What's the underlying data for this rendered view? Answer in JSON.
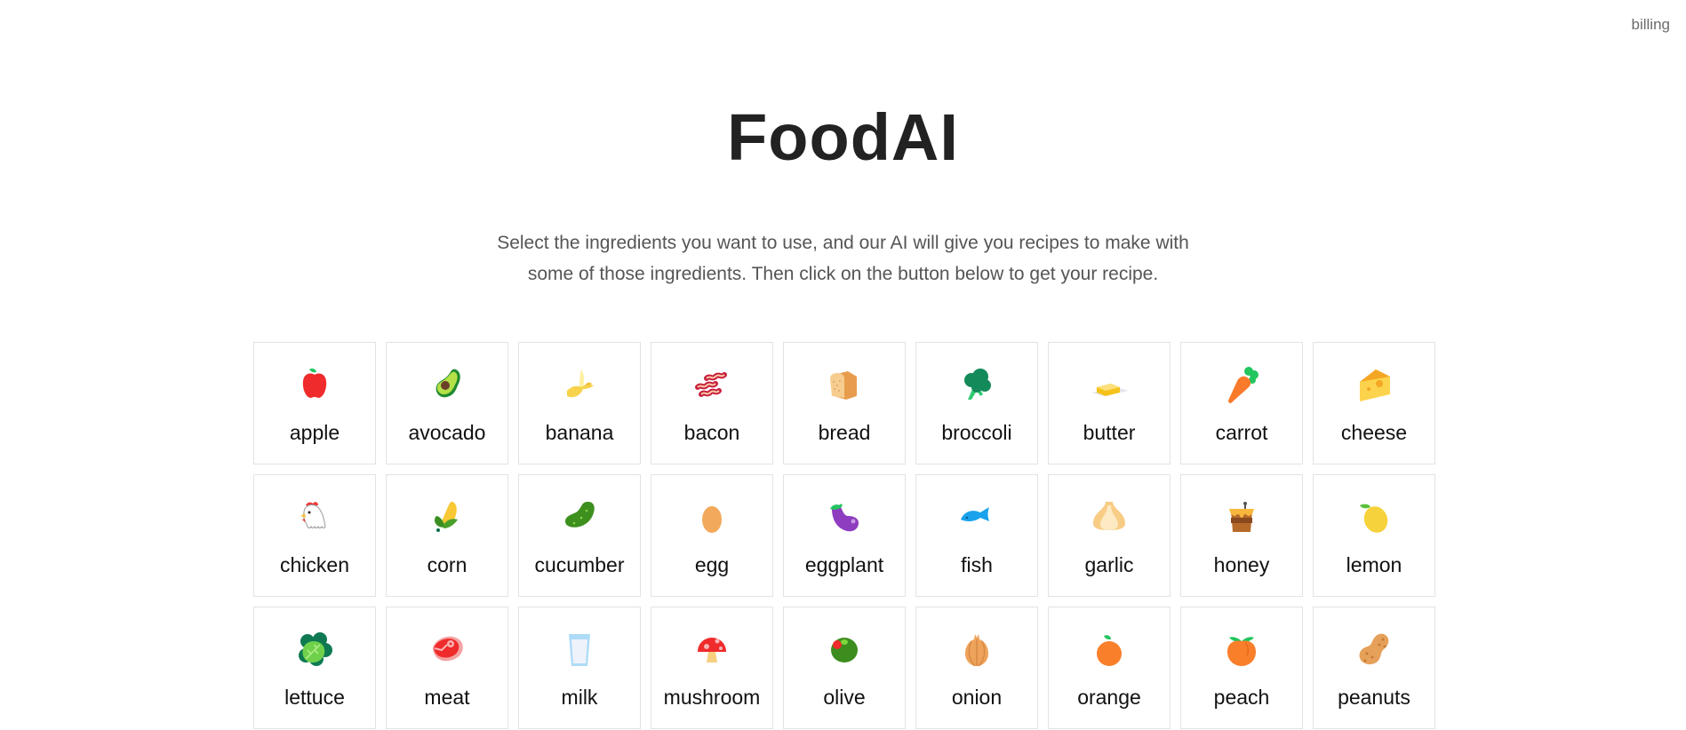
{
  "header": {
    "billing_link": "billing"
  },
  "main": {
    "title": "FoodAI",
    "intro_line1": "Select the ingredients you want to use, and our AI will give you recipes to make with",
    "intro_line2": "some of those ingredients. Then click on the button below to get your recipe."
  },
  "ingredients": [
    {
      "label": "apple",
      "icon": "apple-icon"
    },
    {
      "label": "avocado",
      "icon": "avocado-icon"
    },
    {
      "label": "banana",
      "icon": "banana-icon"
    },
    {
      "label": "bacon",
      "icon": "bacon-icon"
    },
    {
      "label": "bread",
      "icon": "bread-icon"
    },
    {
      "label": "broccoli",
      "icon": "broccoli-icon"
    },
    {
      "label": "butter",
      "icon": "butter-icon"
    },
    {
      "label": "carrot",
      "icon": "carrot-icon"
    },
    {
      "label": "cheese",
      "icon": "cheese-icon"
    },
    {
      "label": "chicken",
      "icon": "chicken-icon"
    },
    {
      "label": "corn",
      "icon": "corn-icon"
    },
    {
      "label": "cucumber",
      "icon": "cucumber-icon"
    },
    {
      "label": "egg",
      "icon": "egg-icon"
    },
    {
      "label": "eggplant",
      "icon": "eggplant-icon"
    },
    {
      "label": "fish",
      "icon": "fish-icon"
    },
    {
      "label": "garlic",
      "icon": "garlic-icon"
    },
    {
      "label": "honey",
      "icon": "honey-icon"
    },
    {
      "label": "lemon",
      "icon": "lemon-icon"
    },
    {
      "label": "lettuce",
      "icon": "lettuce-icon"
    },
    {
      "label": "meat",
      "icon": "meat-icon"
    },
    {
      "label": "milk",
      "icon": "milk-icon"
    },
    {
      "label": "mushroom",
      "icon": "mushroom-icon"
    },
    {
      "label": "olive",
      "icon": "olive-icon"
    },
    {
      "label": "onion",
      "icon": "onion-icon"
    },
    {
      "label": "orange",
      "icon": "orange-icon"
    },
    {
      "label": "peach",
      "icon": "peach-icon"
    },
    {
      "label": "peanuts",
      "icon": "peanuts-icon"
    }
  ]
}
